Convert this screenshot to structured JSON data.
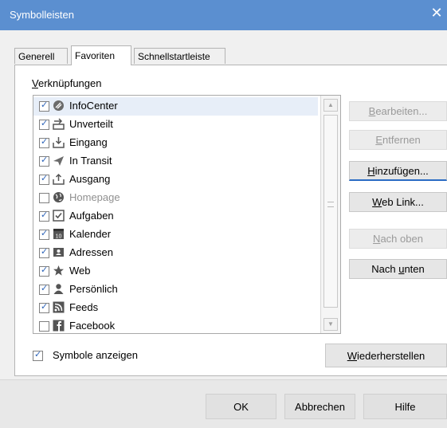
{
  "window": {
    "title": "Symbolleisten",
    "close_glyph": "✕"
  },
  "tabs": [
    {
      "label": "Generell",
      "active": false
    },
    {
      "label": "Favoriten",
      "active": true
    },
    {
      "label": "Schnellstartleiste",
      "active": false
    }
  ],
  "shortcuts_label": {
    "accel": "V",
    "rest": "erknüpfungen"
  },
  "list_items": [
    {
      "label": "InfoCenter",
      "checked": true,
      "icon": "infocenter-icon",
      "selected": true
    },
    {
      "label": "Unverteilt",
      "checked": true,
      "icon": "unassigned-icon"
    },
    {
      "label": "Eingang",
      "checked": true,
      "icon": "inbox-icon"
    },
    {
      "label": "In Transit",
      "checked": true,
      "icon": "send-icon"
    },
    {
      "label": "Ausgang",
      "checked": true,
      "icon": "outbox-icon"
    },
    {
      "label": "Homepage",
      "checked": false,
      "icon": "globe-icon",
      "disabled": true
    },
    {
      "label": "Aufgaben",
      "checked": true,
      "icon": "tasks-icon"
    },
    {
      "label": "Kalender",
      "checked": true,
      "icon": "calendar-icon",
      "icon_text": "10"
    },
    {
      "label": "Adressen",
      "checked": true,
      "icon": "contacts-icon"
    },
    {
      "label": "Web",
      "checked": true,
      "icon": "star-icon"
    },
    {
      "label": "Persönlich",
      "checked": true,
      "icon": "person-icon"
    },
    {
      "label": "Feeds",
      "checked": true,
      "icon": "rss-icon"
    },
    {
      "label": "Facebook",
      "checked": false,
      "icon": "facebook-icon"
    }
  ],
  "side_buttons": {
    "edit": {
      "accel": "B",
      "rest": "earbeiten..."
    },
    "remove": {
      "accel": "E",
      "rest": "ntfernen"
    },
    "add": {
      "accel": "H",
      "rest": "inzufügen..."
    },
    "weblink": {
      "accel": "W",
      "rest": "eb Link..."
    },
    "up": {
      "accel": "N",
      "rest": "ach oben"
    },
    "down": {
      "pre": "Nach ",
      "accel": "u",
      "rest": "nten"
    }
  },
  "show_icons": {
    "label": "Symbole anzeigen",
    "checked": true
  },
  "restore": {
    "accel": "W",
    "rest": "iederherstellen"
  },
  "footer": {
    "ok": "OK",
    "cancel": "Abbrechen",
    "help": "Hilfe"
  },
  "colors": {
    "titlebar": "#5b8fd0",
    "check": "#2c63b8",
    "focus_underline": "#2b6cc4"
  }
}
